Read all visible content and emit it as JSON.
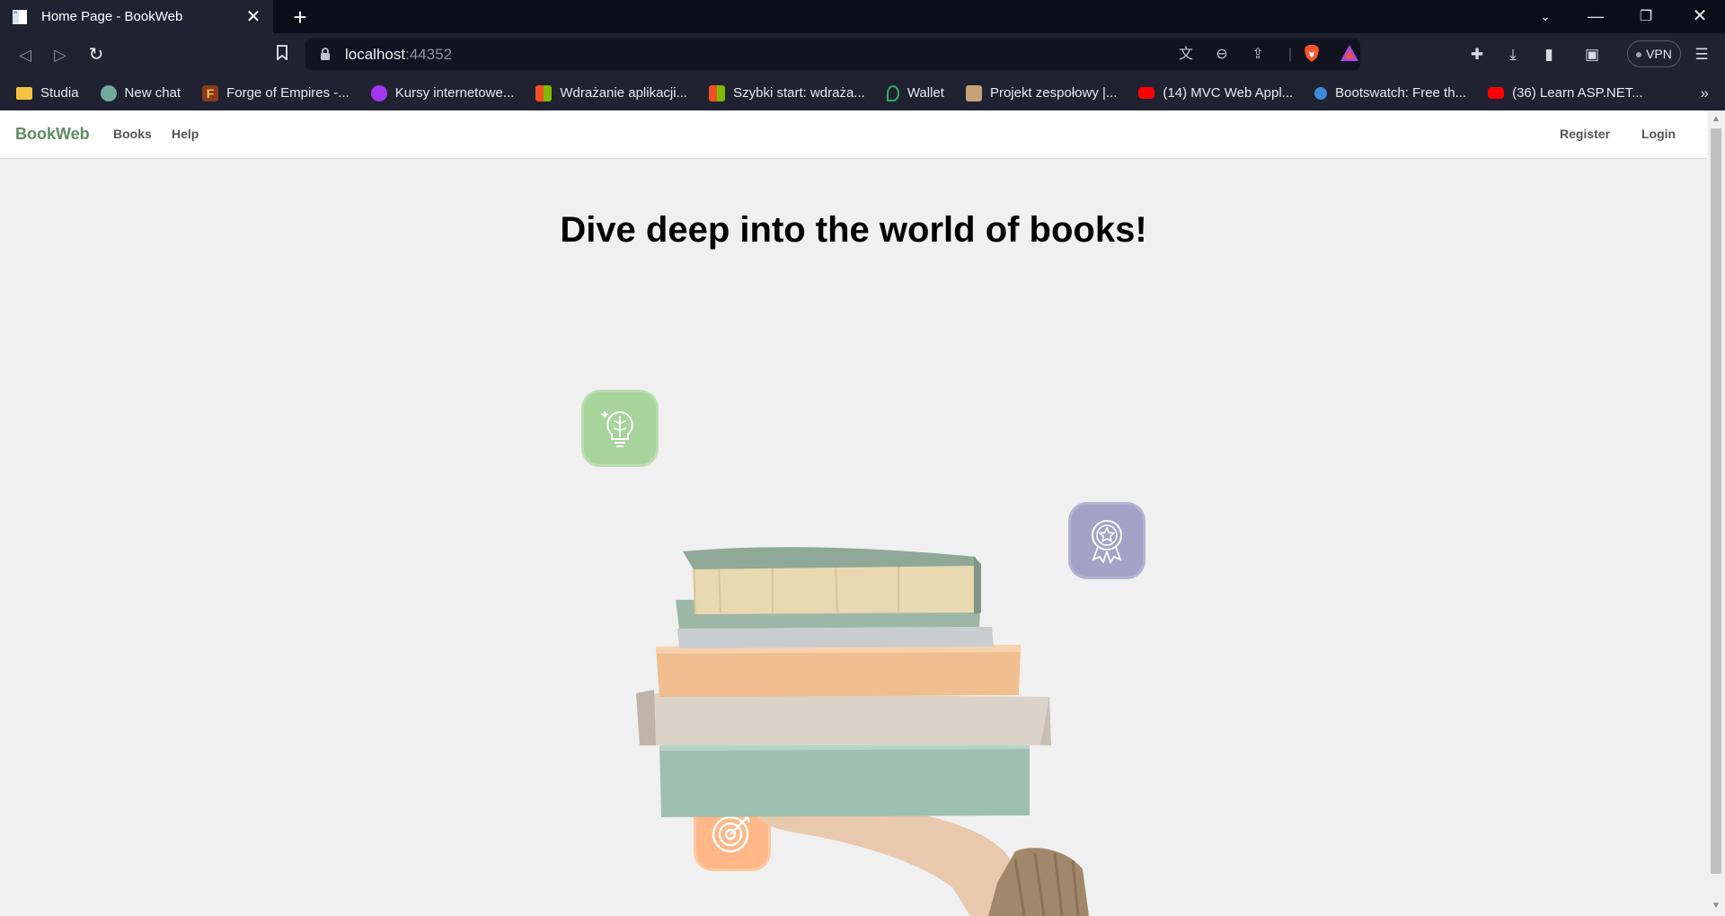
{
  "browser": {
    "tab_title": "Home Page - BookWeb",
    "url_host": "localhost",
    "url_port": ":44352",
    "vpn_label": "VPN",
    "bookmarks": [
      {
        "label": "Studia",
        "icon": "folder-icon",
        "color": "#f5c242"
      },
      {
        "label": "New chat",
        "icon": "chatgpt-icon",
        "color": "#74aa9c"
      },
      {
        "label": "Forge of Empires -...",
        "icon": "forge-of-empires-icon",
        "color": "#8b3a1c"
      },
      {
        "label": "Kursy internetowe...",
        "icon": "udemy-icon",
        "color": "#a435f0"
      },
      {
        "label": "Wdrażanie aplikacji...",
        "icon": "microsoft-icon",
        "color": "#f25022"
      },
      {
        "label": "Szybki start: wdraża...",
        "icon": "microsoft-icon",
        "color": "#f25022"
      },
      {
        "label": "Wallet",
        "icon": "wallet-icon",
        "color": "#2fae60"
      },
      {
        "label": "Projekt zespołowy |...",
        "icon": "book-icon",
        "color": "#c9a27a"
      },
      {
        "label": "(14) MVC Web Appl...",
        "icon": "youtube-icon",
        "color": "#ff0000"
      },
      {
        "label": "Bootswatch: Free th...",
        "icon": "bootswatch-icon",
        "color": "#3d8bd9"
      },
      {
        "label": "(36) Learn ASP.NET...",
        "icon": "youtube-icon",
        "color": "#ff0000"
      }
    ]
  },
  "site": {
    "brand": "BookWeb",
    "nav": {
      "books": "Books",
      "help": "Help",
      "register": "Register",
      "login": "Login"
    },
    "hero_title": "Dive deep into the world of books!",
    "colors": {
      "brand": "#5f8b63",
      "badge_green": "#a6d49a",
      "badge_purple": "#a3a3c8",
      "badge_orange": "#ffb788"
    }
  }
}
